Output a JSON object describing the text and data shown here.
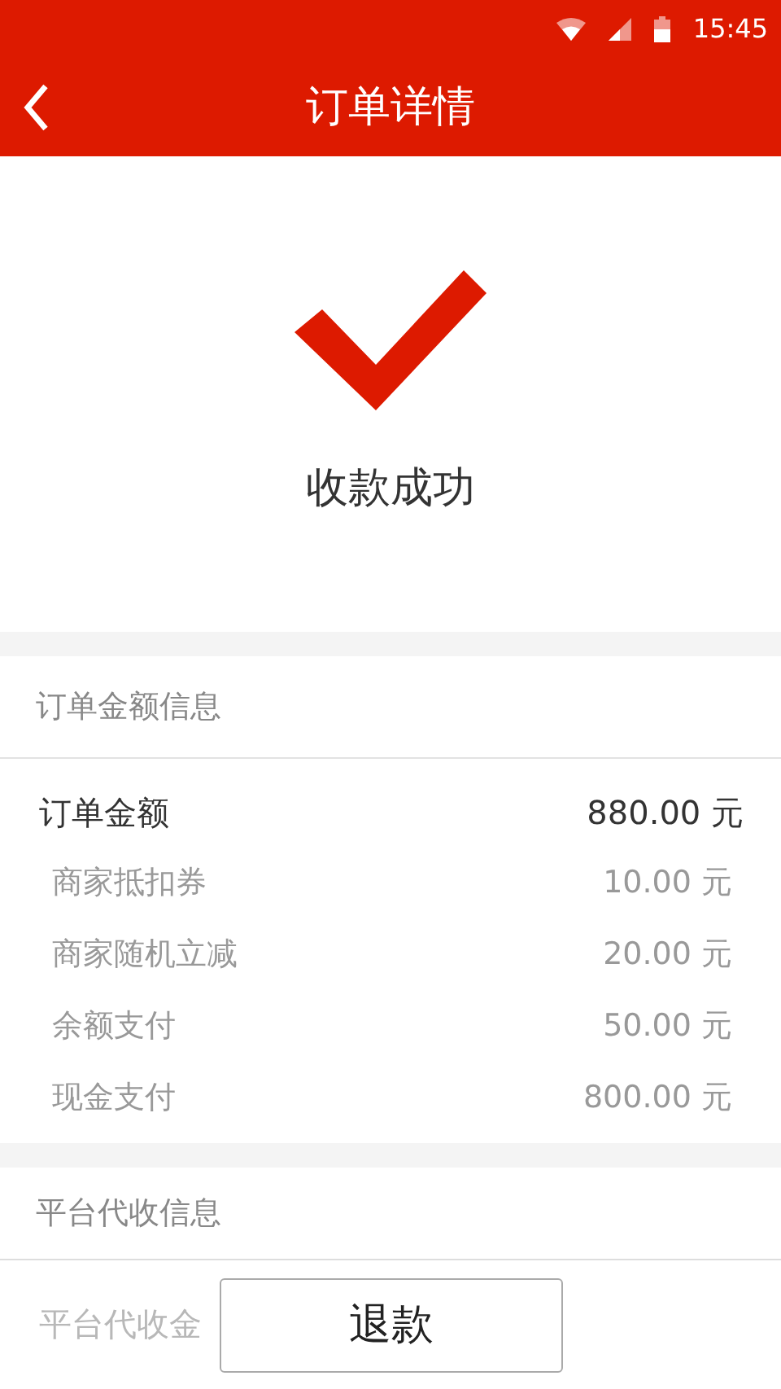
{
  "status_bar": {
    "time": "15:45"
  },
  "header": {
    "title": "订单详情"
  },
  "result": {
    "message": "收款成功"
  },
  "order_section": {
    "title": "订单金额信息",
    "rows": [
      {
        "kind": "total",
        "label": "订单金额",
        "value": "880.00 元"
      },
      {
        "kind": "sub",
        "label": "商家抵扣券",
        "value": "10.00 元"
      },
      {
        "kind": "sub",
        "label": "商家随机立减",
        "value": "20.00 元"
      },
      {
        "kind": "sub",
        "label": "余额支付",
        "value": "50.00 元"
      },
      {
        "kind": "sub",
        "label": "现金支付",
        "value": "800.00 元"
      }
    ]
  },
  "platform_section": {
    "title": "平台代收信息",
    "rows": [
      {
        "label": "平台代收金"
      }
    ]
  },
  "bottom_bar": {
    "button": "退款"
  }
}
